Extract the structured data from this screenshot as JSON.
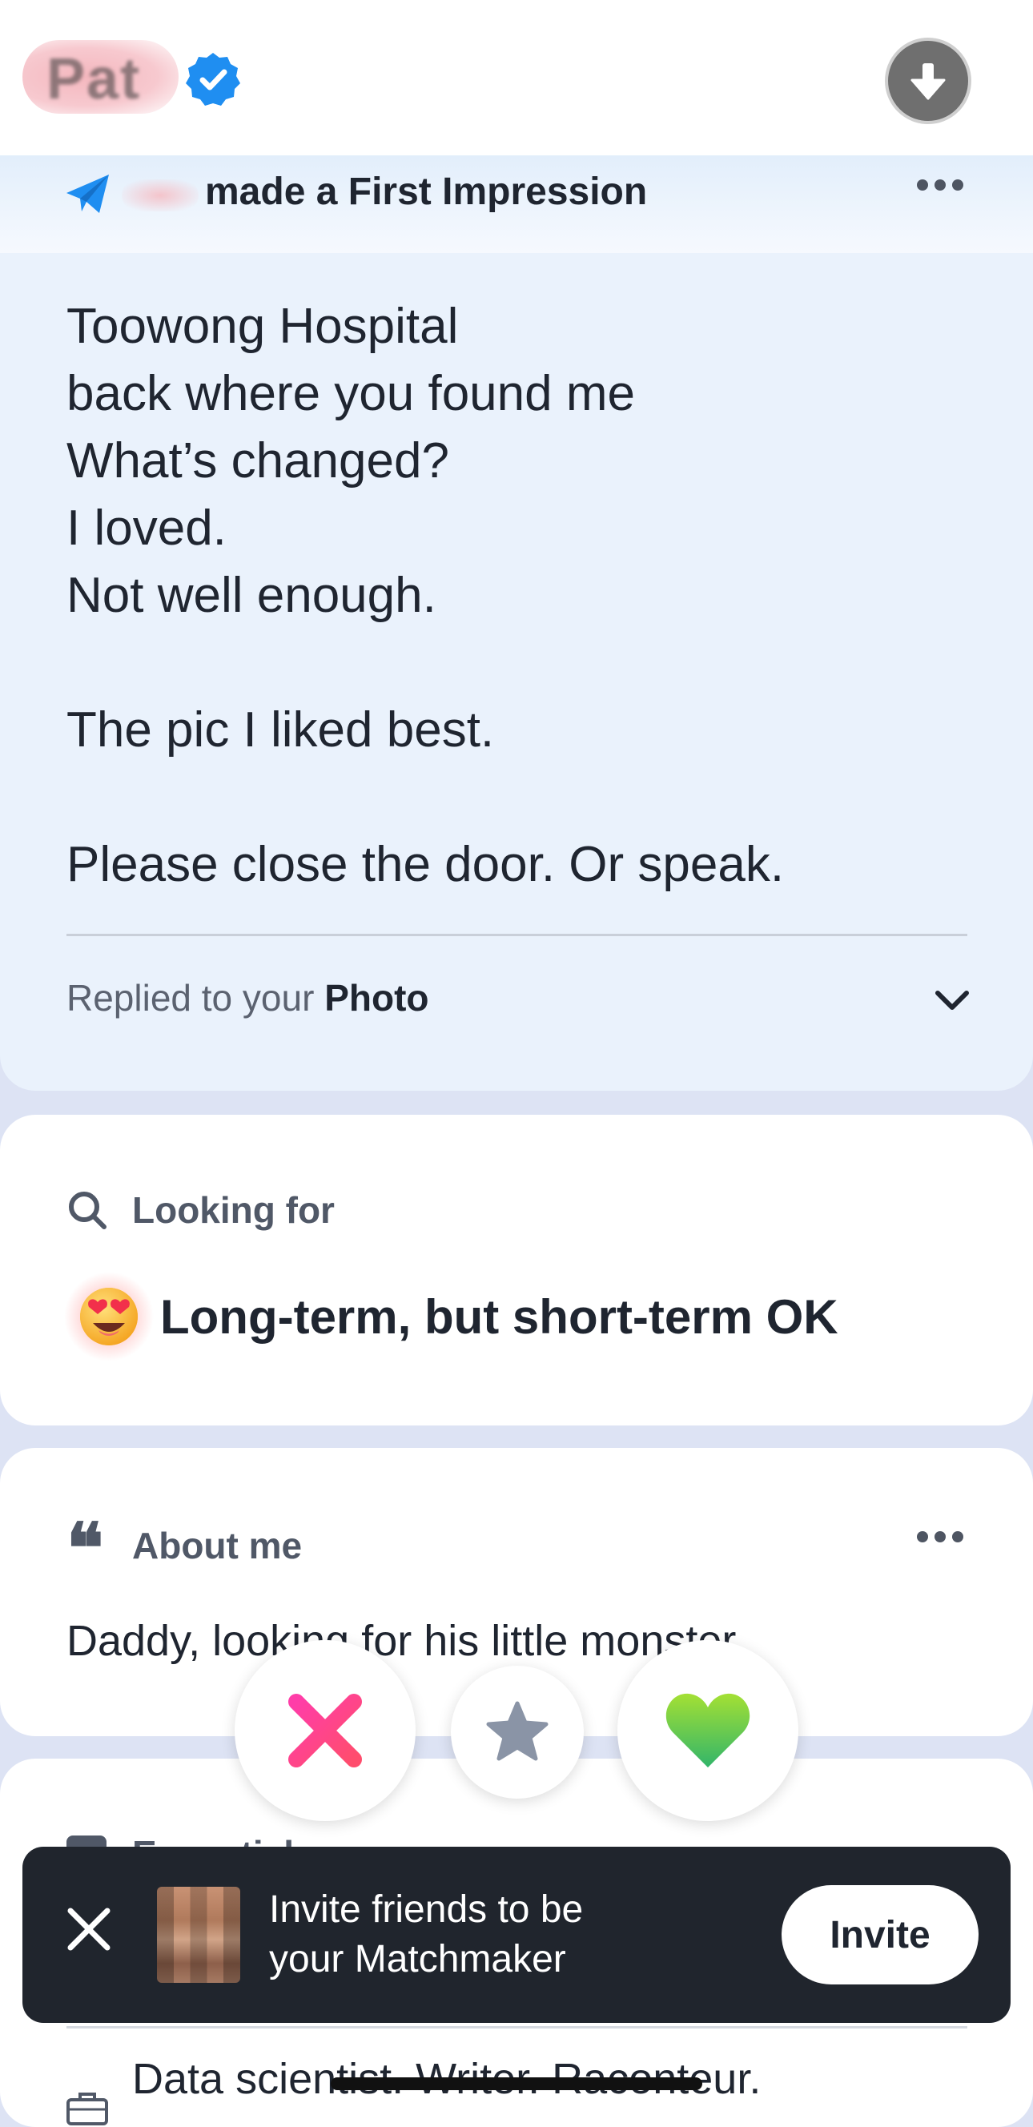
{
  "header": {
    "profile_name": "Pat",
    "verified_icon": "verified-badge-icon",
    "download_icon": "arrow-down-icon"
  },
  "first_impression": {
    "title": "made a First Impression",
    "icon": "paper-plane-icon",
    "message": "Toowong Hospital\nback where you found me\nWhat’s changed?\nI loved.\nNot well enough.\n\nThe pic I liked best.\n\nPlease close the door. Or speak.",
    "replied_prefix": "Replied to your ",
    "replied_target": "Photo"
  },
  "looking_for": {
    "label": "Looking for",
    "emoji": "😍",
    "value": "Long-term, but short-term OK"
  },
  "about_me": {
    "label": "About me",
    "quote_glyph": "❝",
    "text": "Daddy, looking for his little monster."
  },
  "essentials": {
    "label": "Essentials",
    "job_text": "Data scientist. Writer. Raconteur."
  },
  "actions": {
    "nope_icon": "x-icon",
    "super_like_icon": "star-icon",
    "like_icon": "heart-icon"
  },
  "invite": {
    "text": "Invite friends to be your Matchmaker",
    "button_label": "Invite"
  },
  "colors": {
    "card_tint": "#eaf2fc",
    "background": "#dde3f4",
    "nope": "#ff2f9a",
    "star": "#8a94a6",
    "like_top": "#a4e034",
    "like_bottom": "#32b56a",
    "verified": "#1f8ef1",
    "plane": "#1f8ef1"
  }
}
